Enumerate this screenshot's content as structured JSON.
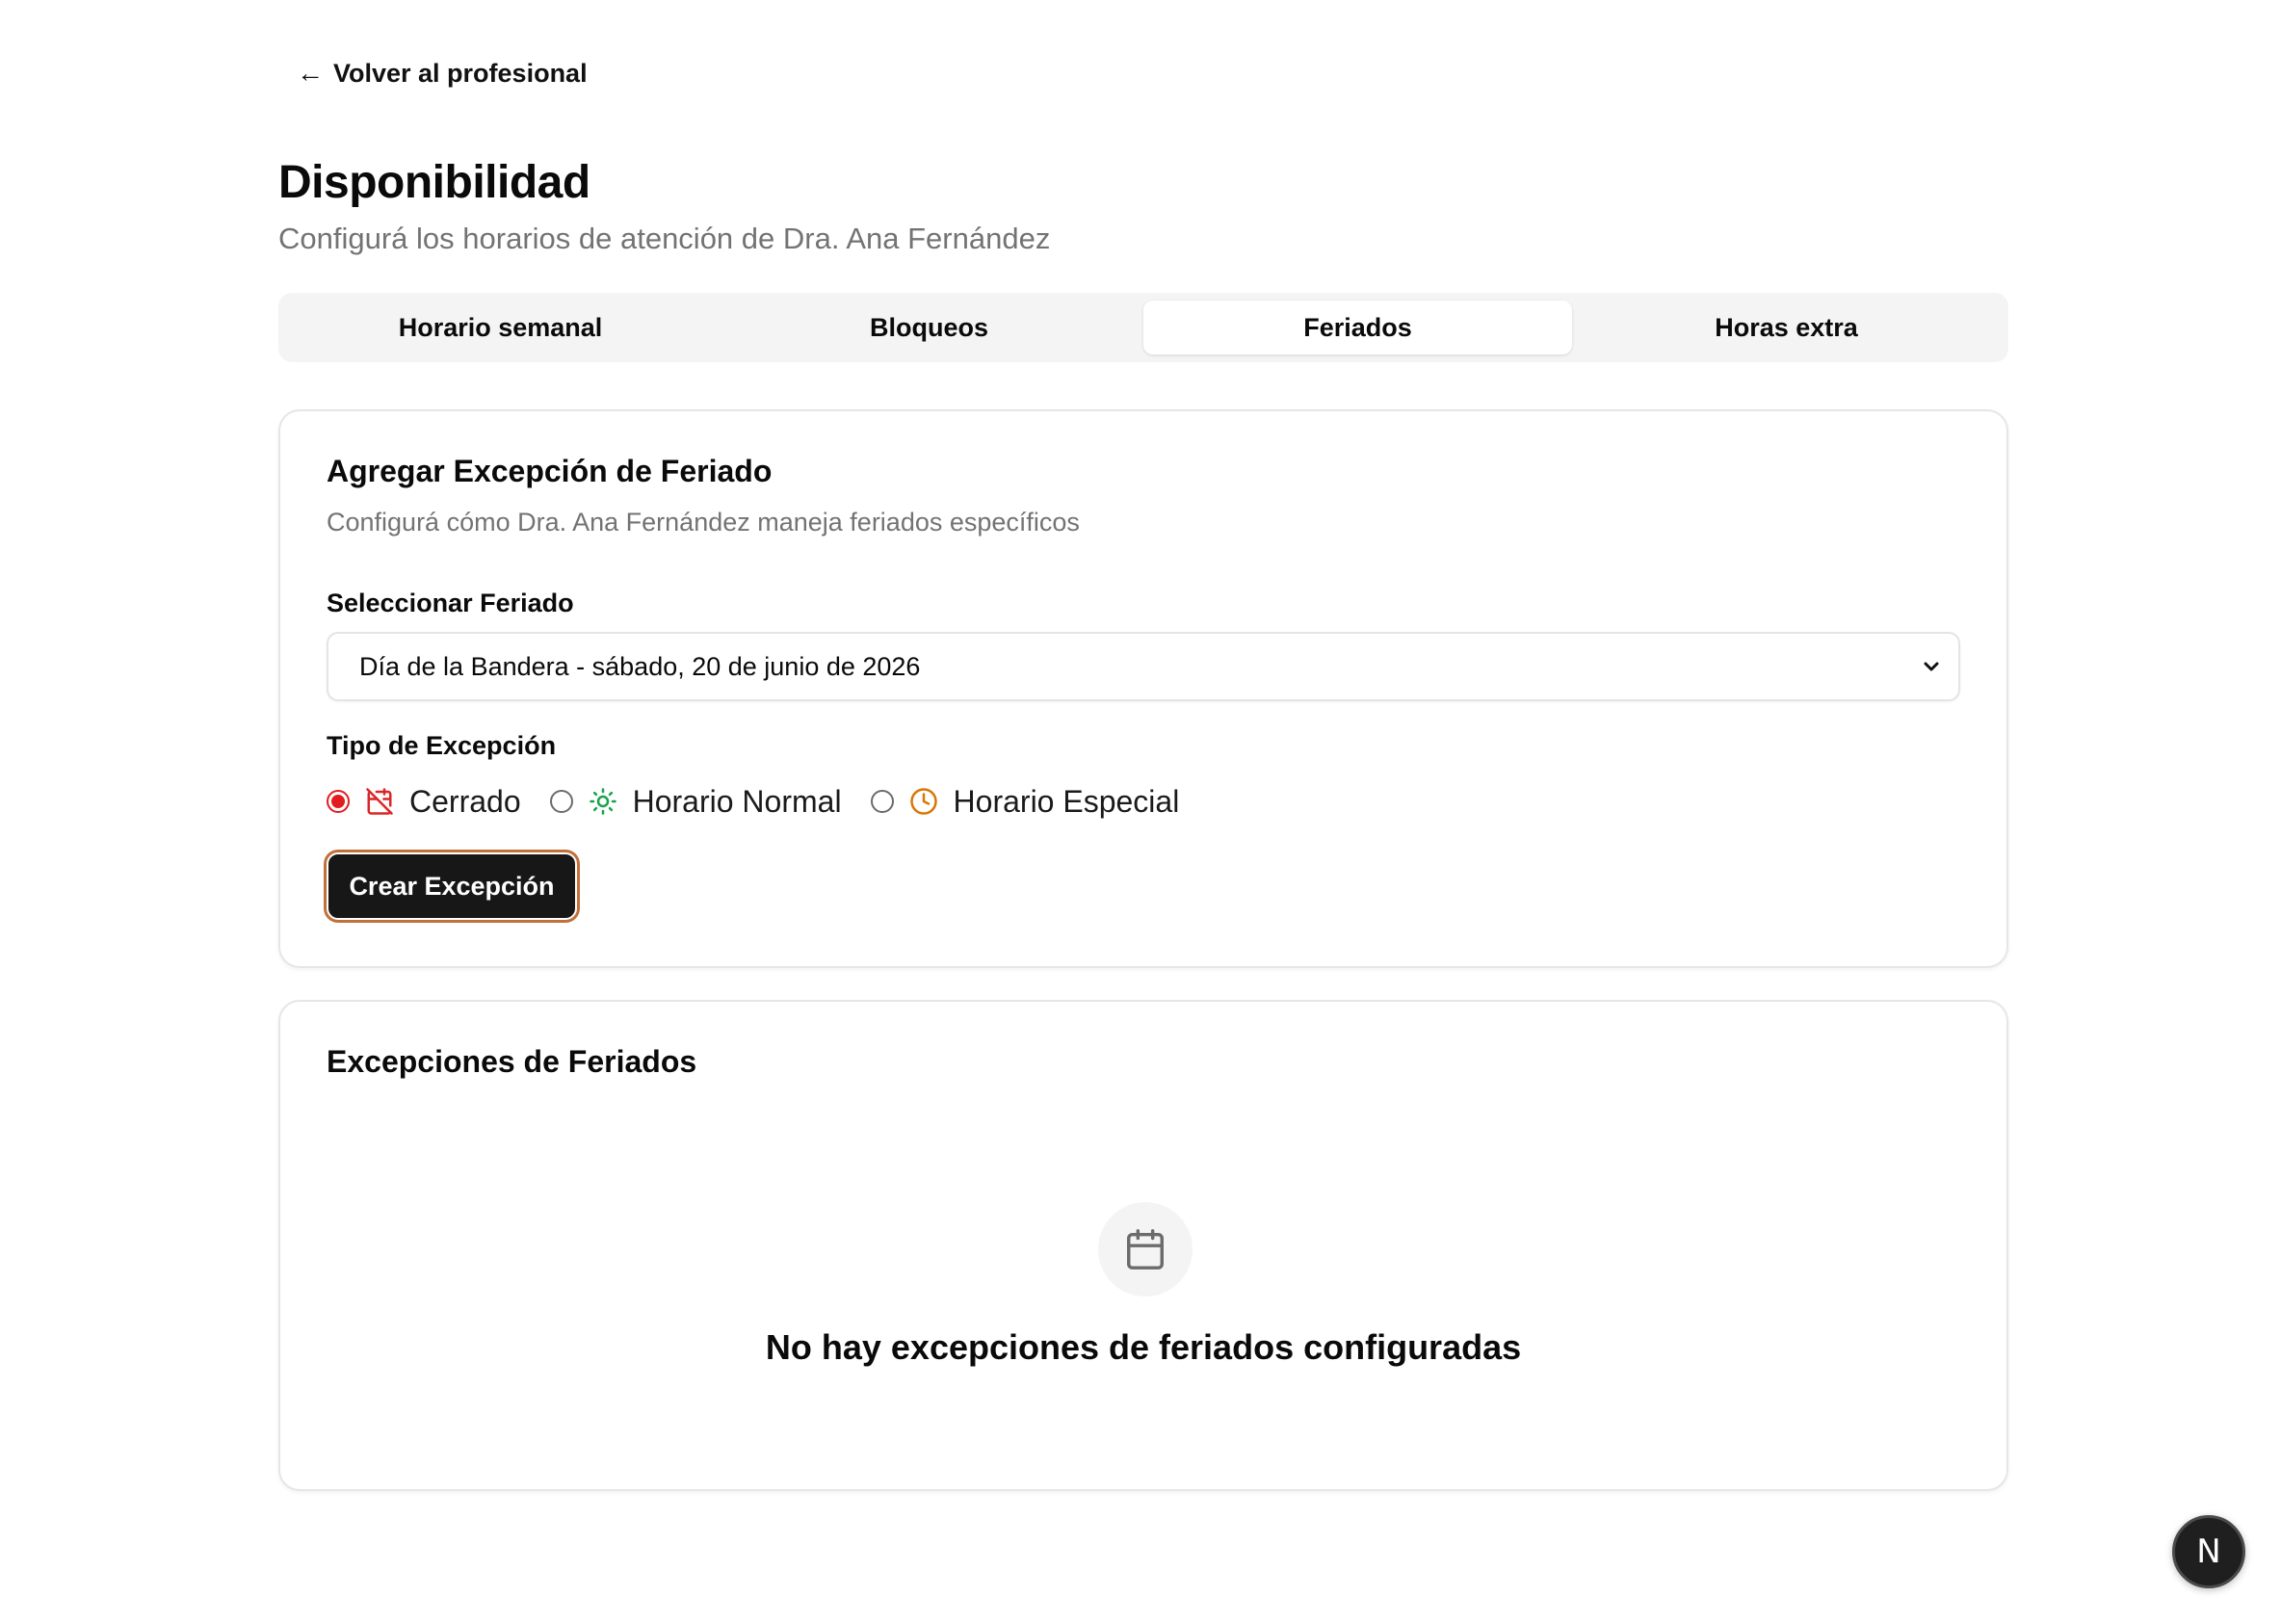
{
  "back_link": {
    "arrow": "←",
    "label": "Volver al profesional"
  },
  "header": {
    "title": "Disponibilidad",
    "subtitle": "Configurá los horarios de atención de Dra. Ana Fernández"
  },
  "tabs": [
    {
      "label": "Horario semanal",
      "active": false
    },
    {
      "label": "Bloqueos",
      "active": false
    },
    {
      "label": "Feriados",
      "active": true
    },
    {
      "label": "Horas extra",
      "active": false
    }
  ],
  "add_card": {
    "title": "Agregar Excepción de Feriado",
    "description": "Configurá cómo Dra. Ana Fernández maneja feriados específicos",
    "select_label": "Seleccionar Feriado",
    "select_value": "Día de la Bandera - sábado, 20 de junio de 2026",
    "type_label": "Tipo de Excepción",
    "options": [
      {
        "label": "Cerrado",
        "icon": "calendar-off-icon",
        "color": "#dc2626",
        "checked": true
      },
      {
        "label": "Horario Normal",
        "icon": "sun-icon",
        "color": "#16a34a",
        "checked": false
      },
      {
        "label": "Horario Especial",
        "icon": "clock-icon",
        "color": "#d97706",
        "checked": false
      }
    ],
    "submit_label": "Crear Excepción"
  },
  "list_card": {
    "title": "Excepciones de Feriados",
    "empty_icon": "calendar-icon",
    "empty_text": "No hay excepciones de feriados configuradas"
  },
  "dev_badge": {
    "letter": "N"
  },
  "colors": {
    "accent_dark": "#171717",
    "focus_ring": "#c2703a",
    "muted_text": "#737373",
    "tab_bg": "#f4f4f5"
  }
}
